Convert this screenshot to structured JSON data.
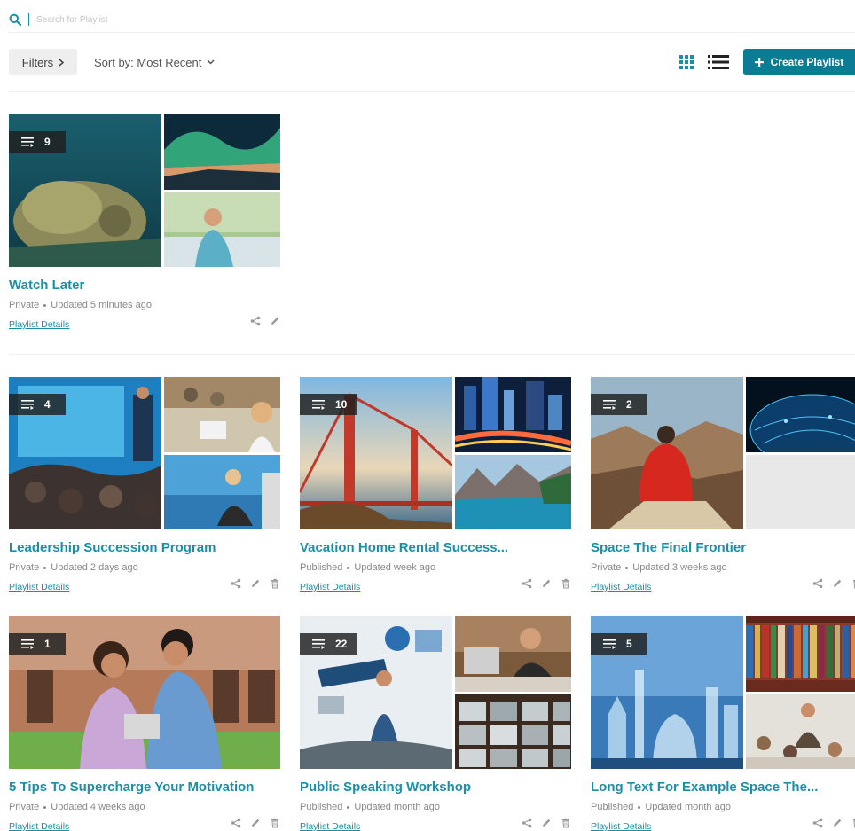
{
  "search": {
    "placeholder": "Search for Playlist"
  },
  "toolbar": {
    "filters_label": "Filters",
    "sort_label": "Sort by: Most Recent",
    "create_label": "Create Playlist"
  },
  "colors": {
    "accent": "#1a8fa6",
    "button": "#0a7c93",
    "badge": "#222222"
  },
  "playlists": [
    {
      "title": "Watch Later",
      "count": "9",
      "status": "Private",
      "updated": "Updated 5 minutes ago",
      "details": "Playlist Details"
    },
    {
      "title": "Leadership Succession Program",
      "count": "4",
      "status": "Private",
      "updated": "Updated 2 days ago",
      "details": "Playlist Details"
    },
    {
      "title": "Vacation Home Rental Success...",
      "count": "10",
      "status": "Published",
      "updated": "Updated week ago",
      "details": "Playlist Details"
    },
    {
      "title": "Space The Final Frontier",
      "count": "2",
      "status": "Private",
      "updated": "Updated 3 weeks ago",
      "details": "Playlist Details"
    },
    {
      "title": "5 Tips To Supercharge Your Motivation",
      "count": "1",
      "status": "Private",
      "updated": "Updated 4 weeks ago",
      "details": "Playlist Details"
    },
    {
      "title": "Public Speaking Workshop",
      "count": "22",
      "status": "Published",
      "updated": "Updated month ago",
      "details": "Playlist Details"
    },
    {
      "title": "Long Text For Example Space The...",
      "count": "5",
      "status": "Published",
      "updated": "Updated month ago",
      "details": "Playlist Details"
    }
  ]
}
